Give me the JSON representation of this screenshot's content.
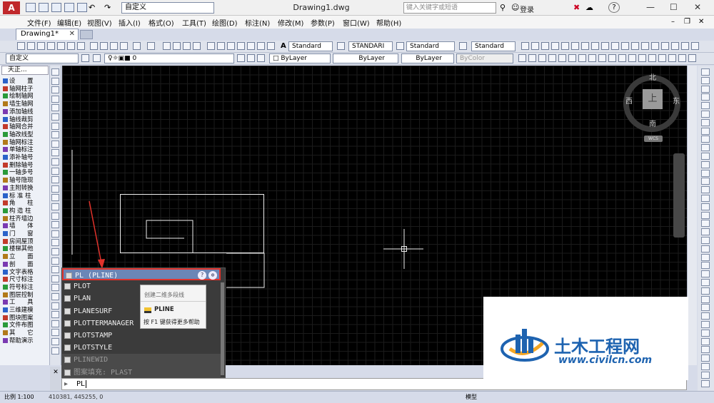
{
  "titlebar": {
    "workspace": "自定义",
    "document_title": "Drawing1.dwg",
    "search_placeholder": "键入关键字或短语",
    "login": "登录",
    "minimize": "—",
    "maximize": "☐",
    "close": "✕"
  },
  "menubar": [
    "文件(F)",
    "编辑(E)",
    "视图(V)",
    "插入(I)",
    "格式(O)",
    "工具(T)",
    "绘图(D)",
    "标注(N)",
    "修改(M)",
    "参数(P)",
    "窗口(W)",
    "帮助(H)"
  ],
  "doc_tabs": {
    "active": "Drawing1*",
    "close": "✕"
  },
  "toolbar_styles": {
    "text_style": "Standard",
    "dim_style": "STANDARI",
    "table_style": "Standard",
    "mleader_style": "Standard"
  },
  "toolbar_layers": {
    "workspace": "自定义",
    "layer": "0",
    "color": "ByLayer",
    "linetype": "ByLayer",
    "lineweight": "ByLayer",
    "plotstyle": "ByColor"
  },
  "tianzheng": {
    "header": "天正...",
    "items": [
      "设　　置",
      "轴网柱子",
      "绘制轴网",
      "墙生轴网",
      "添加轴线",
      "轴线裁剪",
      "轴网合并",
      "轴改线型",
      "轴网标注",
      "单轴标注",
      "添补轴号",
      "删除轴号",
      "一轴多号",
      "轴号隐现",
      "主附转换",
      "标 准 柱",
      "角　　柱",
      "构 造 柱",
      "柱齐墙边",
      "墙　　体",
      "门　　窗",
      "房间屋顶",
      "楼梯其他",
      "立　　面",
      "剖　　面",
      "文字表格",
      "尺寸标注",
      "符号标注",
      "图层控制",
      "工　　具",
      "三维建模",
      "图块图案",
      "文件布图",
      "其　　它",
      "帮助演示"
    ]
  },
  "nav": {
    "north": "北",
    "south": "南",
    "east": "东",
    "west": "西",
    "top": "上",
    "wcs": "WCS"
  },
  "autocomplete": {
    "rows": [
      "PL (PLINE)",
      "PLOT",
      "PLAN",
      "PLANESURF",
      "PLOTTERMANAGER",
      "PLOTSTAMP",
      "PLOTSTYLE",
      "PLINEWID",
      "图案填充: PLAST"
    ],
    "tooltip_desc": "创建二维多段线",
    "tooltip_cmd": "PLINE",
    "tooltip_help": "按 F1 键获得更多帮助"
  },
  "command_line": {
    "input": "PL"
  },
  "statusbar": {
    "scale": "比例 1:100",
    "coords": "410381, 445255, 0",
    "model": "模型"
  },
  "watermark": {
    "cn": "土木工程网",
    "url": "www.civilcn.com"
  },
  "colors": {
    "canvas": "#000000",
    "selected_row": "#6b86b6",
    "highlight_border": "#e0322b",
    "watermark": "#1e63b0"
  }
}
